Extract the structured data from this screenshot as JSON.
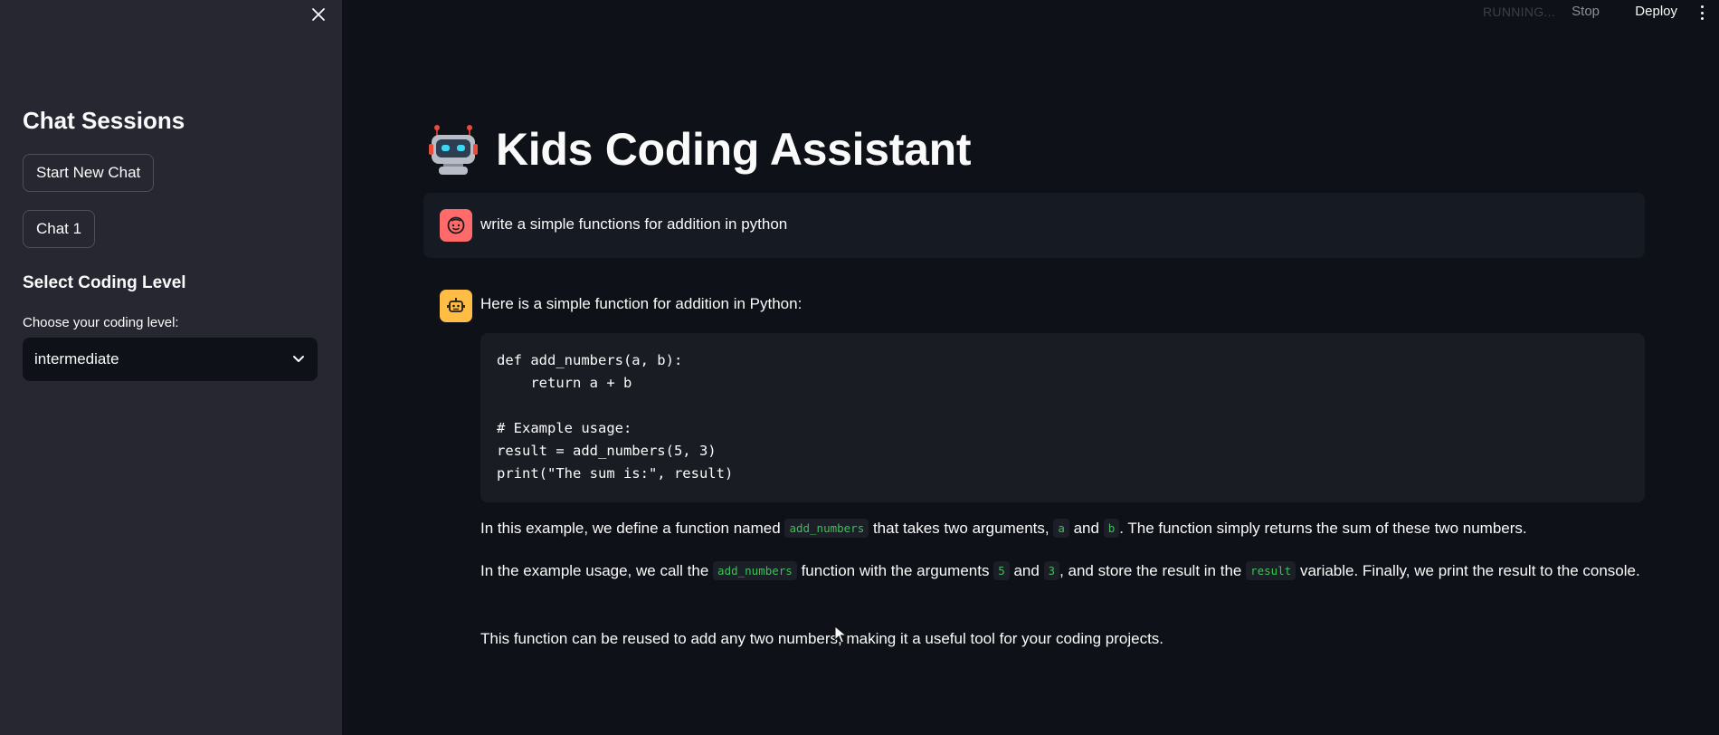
{
  "topbar": {
    "status": "RUNNING...",
    "stop_label": "Stop",
    "deploy_label": "Deploy",
    "menu_icon": "kebab-menu-icon"
  },
  "sidebar": {
    "close_icon": "close-icon",
    "title": "Chat Sessions",
    "new_chat_label": "Start New Chat",
    "sessions": [
      "Chat 1"
    ],
    "level_title": "Select Coding Level",
    "level_label": "Choose your coding level:",
    "level_value": "intermediate"
  },
  "main": {
    "title_icon": "robot-icon",
    "title": "Kids Coding Assistant",
    "user_message": "write a simple functions for addition in python",
    "assistant": {
      "intro": "Here is a simple function for addition in Python:",
      "code": "def add_numbers(a, b):\n    return a + b\n\n# Example usage:\nresult = add_numbers(5, 3)\nprint(\"The sum is:\", result)",
      "p1": {
        "t1": "In this example, we define a function named ",
        "c1": "add_numbers",
        "t2": " that takes two arguments, ",
        "c2": "a",
        "t3": " and ",
        "c3": "b",
        "t4": ". The function simply returns the sum of these two numbers."
      },
      "p2": {
        "t1": "In the example usage, we call the ",
        "c1": "add_numbers",
        "t2": " function with the arguments ",
        "c2": "5",
        "t3": " and ",
        "c3": "3",
        "t4": ", and store the result in the ",
        "c4": "result",
        "t5": " variable. Finally, we print the result to the console."
      },
      "p3": "This function can be reused to add any two numbers, making it a useful tool for your coding projects."
    }
  },
  "colors": {
    "background": "#0e1117",
    "sidebar": "#262730",
    "user_avatar": "#ff6b6b",
    "assistant_avatar": "#ffbd45",
    "inline_code": "#3fbf5a"
  }
}
